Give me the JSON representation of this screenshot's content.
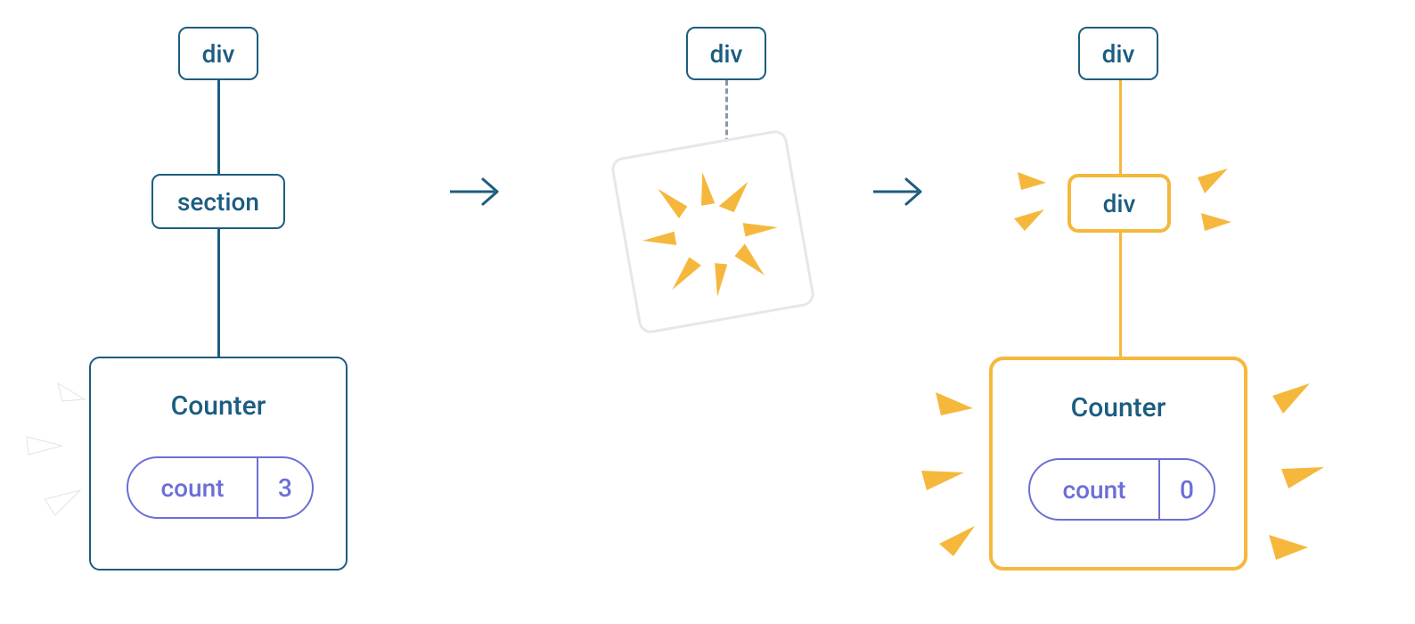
{
  "trees": {
    "left": {
      "root": "div",
      "child": "section",
      "counter": {
        "title": "Counter",
        "label": "count",
        "value": "3"
      }
    },
    "middle": {
      "root": "div"
    },
    "right": {
      "root": "div",
      "child": "div",
      "counter": {
        "title": "Counter",
        "label": "count",
        "value": "0"
      }
    }
  },
  "colors": {
    "blue": "#1c5d80",
    "gold": "#f5b83d",
    "purple": "#6b6fd6",
    "white": "#ffffff",
    "dash": "#8a99a3"
  }
}
